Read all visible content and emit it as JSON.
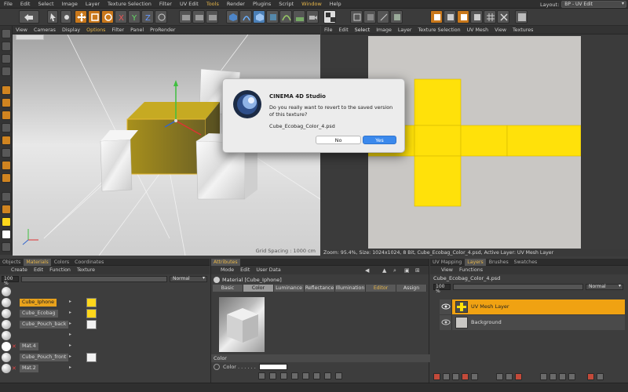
{
  "menubar": {
    "items": [
      "File",
      "Edit",
      "Select",
      "Image",
      "Layer",
      "Texture Selection",
      "Filter",
      "UV Edit",
      "Tools",
      "Render",
      "Plugins",
      "Script",
      "Window",
      "Help"
    ],
    "highlighted": [
      "Tools",
      "Window"
    ],
    "layout_label": "Layout:",
    "layout_value": "BP - UV Edit"
  },
  "viewport": {
    "menu": [
      "View",
      "Cameras",
      "Display",
      "Options",
      "Filter",
      "Panel",
      "ProRender"
    ],
    "highlighted": [
      "Options"
    ],
    "grid_spacing": "Grid Spacing : 1000 cm"
  },
  "uv_editor": {
    "menu": [
      "File",
      "Edit",
      "Select",
      "Image",
      "Layer",
      "Texture Selection",
      "UV Mesh",
      "View",
      "Textures"
    ],
    "highlighted": [
      "Select"
    ],
    "status": "Zoom: 95.4%, Size: 1024x1024, 8 Bit, Cube_Ecobag_Color_4.psd, Active Layer: UV Mesh Layer",
    "uv_color": "#ffe10a"
  },
  "dialog": {
    "title": "CINEMA 4D Studio",
    "message": "Do you really want to revert to the saved version of this texture?",
    "file": "Cube_Ecobag_Color_4.psd",
    "no_label": "No",
    "yes_label": "Yes"
  },
  "materials_panel": {
    "tabs": [
      "Objects",
      "Materials",
      "Colors",
      "Coordinates"
    ],
    "active_tab": "Materials",
    "menu": [
      "Create",
      "Edit",
      "Function",
      "Texture"
    ],
    "percent": "100 %",
    "blend_mode": "Normal",
    "rows": [
      {
        "name": "Cube_Iphone",
        "selected": true,
        "texture": "yellow"
      },
      {
        "name": "Cube_Ecobag",
        "selected": false,
        "texture": "yellow"
      },
      {
        "name": "Cube_Pouch_back",
        "selected": false,
        "texture": "white"
      },
      {
        "name": "",
        "selected": false,
        "texture": "none"
      },
      {
        "name": "Mat.4",
        "selected": false,
        "texture": "none",
        "error": true
      },
      {
        "name": "Cube_Pouch_front",
        "selected": false,
        "texture": "white"
      },
      {
        "name": "Mat.2",
        "selected": false,
        "texture": "none",
        "error": true
      }
    ]
  },
  "attributes_panel": {
    "tab": "Attributes",
    "menu": [
      "Mode",
      "Edit",
      "User Data"
    ],
    "material_title": "Material [Cube_Iphone]",
    "tabs": [
      "Basic",
      "Color",
      "Luminance",
      "Reflectance",
      "Illumination",
      "Editor",
      "Assign"
    ],
    "selected_tab": "Color",
    "section": "Color",
    "color_label": "Color . . . . . .",
    "color_value": "#ffffff"
  },
  "layers_panel": {
    "tabs": [
      "UV Mapping",
      "Layers",
      "Brushes",
      "Swatches"
    ],
    "active_tab": "Layers",
    "menu": [
      "View",
      "Functions"
    ],
    "file": "Cube_Ecobag_Color_4.psd",
    "percent": "100 %",
    "blend_mode": "Normal",
    "layers": [
      {
        "name": "UV Mesh Layer",
        "active": true
      },
      {
        "name": "Background",
        "active": false
      }
    ]
  },
  "colors": {
    "accent": "#e9a21c",
    "panel": "#3d3d3d",
    "active_layer": "#f0a212",
    "dialog_yes": "#3b89ec"
  }
}
